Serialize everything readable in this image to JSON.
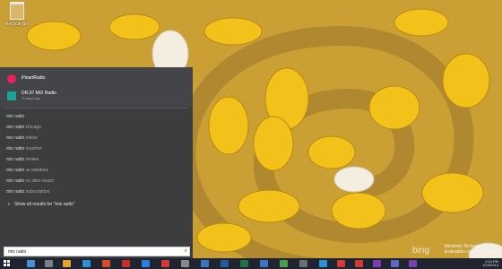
{
  "desktop": {
    "recycle_bin_label": "Recycle Bin"
  },
  "apps": [
    {
      "name": "iHeartRadio",
      "sub": "",
      "icon": "iheartradio-icon",
      "color": "#e6245c"
    },
    {
      "name": "DR.97 MIX Radio",
      "sub": "Trusted app",
      "icon": "radio-app-icon",
      "color": "#1aa49a"
    }
  ],
  "suggestions": [
    {
      "query": "mix radio",
      "rest": ""
    },
    {
      "query": "mix radio",
      "rest": " chicago"
    },
    {
      "query": "mix radio",
      "rest": " online"
    },
    {
      "query": "mix radio",
      "rest": " voucher"
    },
    {
      "query": "mix radio",
      "rest": " review"
    },
    {
      "query": "mix radio",
      "rest": " vs pandora"
    },
    {
      "query": "mix radio",
      "rest": " vs xbox music"
    },
    {
      "query": "mix radio",
      "rest": " subscription"
    }
  ],
  "show_all": "Show all results for \"mix radio\"",
  "search": {
    "value": "mix radio"
  },
  "watermark": {
    "line1": "Windows Technical Preview",
    "line2": "Evaluation copy. Build 9841"
  },
  "bing_text": "bing",
  "clock": {
    "time": "2:04 PM",
    "date": "10/3/2014"
  }
}
